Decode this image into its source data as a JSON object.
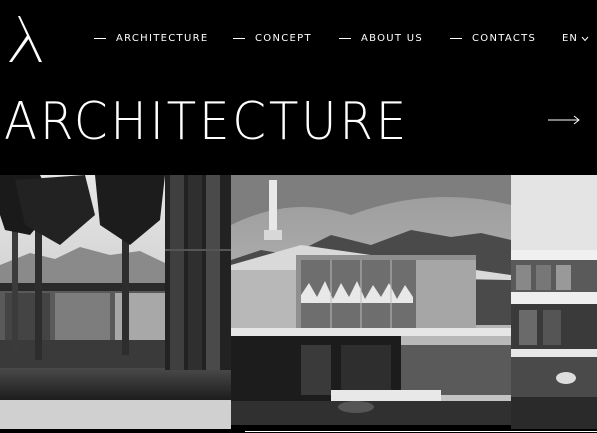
{
  "nav": {
    "items": [
      {
        "label": "ARCHITECTURE"
      },
      {
        "label": "CONCEPT"
      },
      {
        "label": "ABOUT US"
      },
      {
        "label": "CONTACTS"
      }
    ],
    "language": "EN"
  },
  "hero": {
    "title": "ARCHITECTURE"
  },
  "icons": {
    "logo": "lambda-logo-icon",
    "arrow": "arrow-right-icon",
    "chevron": "chevron-down-icon"
  },
  "colors": {
    "background": "#000000",
    "text": "#ffffff"
  }
}
